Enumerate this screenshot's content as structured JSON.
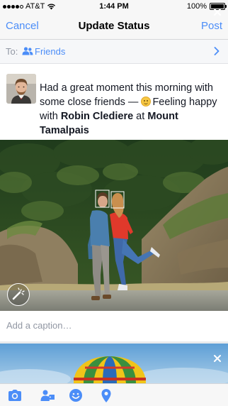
{
  "status_bar": {
    "carrier": "AT&T",
    "time": "1:44 PM",
    "battery": "100%",
    "battery_level": 1.0,
    "signal_bars": 4
  },
  "nav": {
    "cancel": "Cancel",
    "title": "Update Status",
    "post": "Post"
  },
  "audience": {
    "to_label": "To:",
    "value": "Friends",
    "icon": "friends-icon"
  },
  "status": {
    "text_1": "Had a great moment this morning with some close friends — ",
    "feeling": "Feeling happy",
    "with_label": " with ",
    "tagged_person": "Robin Clediere",
    "at_label": " at ",
    "place": "Mount Tamalpais"
  },
  "caption": {
    "placeholder": "Add a caption…"
  },
  "toolbar": {
    "icons": [
      "camera-icon",
      "tag-people-icon",
      "feeling-icon",
      "location-icon"
    ]
  },
  "colors": {
    "accent": "#4b8df8",
    "text": "#141823",
    "muted": "#9197a3"
  }
}
